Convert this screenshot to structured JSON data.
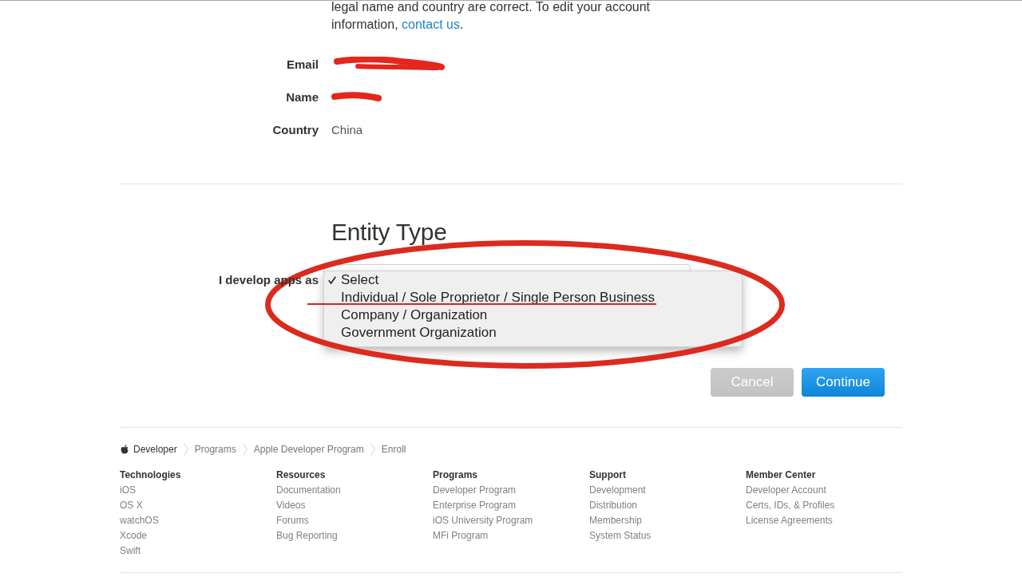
{
  "account": {
    "intro": {
      "text": "legal name and country are correct. To edit your account information, ",
      "link": "contact us",
      "end": "."
    },
    "rows": [
      {
        "label": "Email",
        "kind": "redacted"
      },
      {
        "label": "Name",
        "kind": "redacted"
      },
      {
        "label": "Country",
        "kind": "text",
        "value": "China"
      }
    ]
  },
  "entity_type": {
    "title": "Entity Type",
    "field_label": "I develop apps as",
    "dropdown": {
      "expanded": true,
      "circled": true,
      "options": [
        {
          "label": "Select",
          "selected": true,
          "underlined": false
        },
        {
          "label": "Individual / Sole Proprietor / Single Person Business",
          "selected": false,
          "underlined": true
        },
        {
          "label": "Company / Organization",
          "selected": false,
          "underlined": false
        },
        {
          "label": "Government Organization",
          "selected": false,
          "underlined": false
        }
      ]
    }
  },
  "buttons": [
    {
      "label": "Cancel",
      "kind": "secondary"
    },
    {
      "label": "Continue",
      "kind": "primary"
    }
  ],
  "footer": {
    "breadcrumb": [
      {
        "label": "Developer",
        "kind": "home"
      },
      {
        "label": "Programs",
        "kind": "link"
      },
      {
        "label": "Apple Developer Program",
        "kind": "link"
      },
      {
        "label": "Enroll",
        "kind": "link"
      }
    ],
    "columns": [
      {
        "heading": "Technologies",
        "links": [
          "iOS",
          "OS X",
          "watchOS",
          "Xcode",
          "Swift"
        ]
      },
      {
        "heading": "Resources",
        "links": [
          "Documentation",
          "Videos",
          "Forums",
          "Bug Reporting"
        ]
      },
      {
        "heading": "Programs",
        "links": [
          "Developer Program",
          "Enterprise Program",
          "iOS University Program",
          "MFi Program"
        ]
      },
      {
        "heading": "Support",
        "links": [
          "Development",
          "Distribution",
          "Membership",
          "System Status"
        ]
      },
      {
        "heading": "Member Center",
        "links": [
          "Developer Account",
          "Certs, IDs, & Profiles",
          "License Agreements"
        ]
      }
    ]
  }
}
